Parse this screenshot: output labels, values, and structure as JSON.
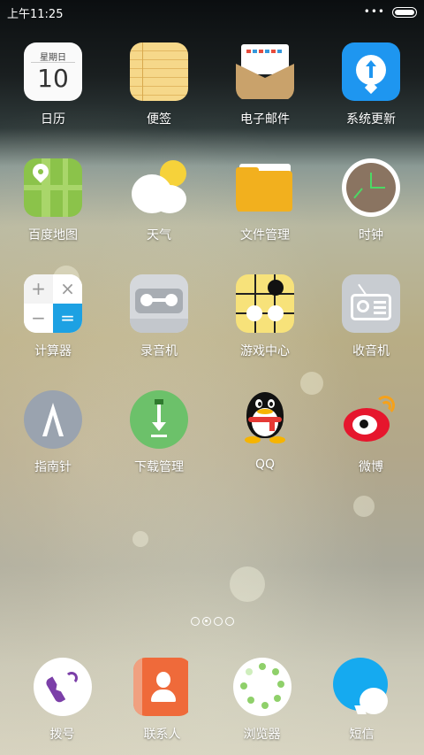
{
  "status_bar": {
    "time": "上午11:25",
    "overflow": "•••"
  },
  "home_grid": [
    [
      {
        "label": "日历",
        "icon": "calendar-icon",
        "sub_text": "星期日",
        "day": "10"
      },
      {
        "label": "便签",
        "icon": "notes-icon"
      },
      {
        "label": "电子邮件",
        "icon": "email-icon"
      },
      {
        "label": "系统更新",
        "icon": "update-icon"
      }
    ],
    [
      {
        "label": "百度地图",
        "icon": "map-icon"
      },
      {
        "label": "天气",
        "icon": "weather-icon"
      },
      {
        "label": "文件管理",
        "icon": "folder-icon"
      },
      {
        "label": "时钟",
        "icon": "clock-icon"
      }
    ],
    [
      {
        "label": "计算器",
        "icon": "calculator-icon"
      },
      {
        "label": "录音机",
        "icon": "recorder-icon"
      },
      {
        "label": "游戏中心",
        "icon": "game-center-icon"
      },
      {
        "label": "收音机",
        "icon": "radio-icon"
      }
    ],
    [
      {
        "label": "指南针",
        "icon": "compass-icon"
      },
      {
        "label": "下载管理",
        "icon": "download-icon"
      },
      {
        "label": "QQ",
        "icon": "qq-icon"
      },
      {
        "label": "微博",
        "icon": "weibo-icon"
      }
    ]
  ],
  "page_indicator": {
    "pages": 4,
    "current": 2
  },
  "dock": [
    {
      "label": "拨号",
      "icon": "phone-icon"
    },
    {
      "label": "联系人",
      "icon": "contacts-icon"
    },
    {
      "label": "浏览器",
      "icon": "browser-icon"
    },
    {
      "label": "短信",
      "icon": "messages-icon"
    }
  ],
  "colors": {
    "calculator_accent": "#1da1e3",
    "update_blue": "#1e96f0",
    "download_green": "#6cc16a",
    "contacts_orange": "#ef6a3a",
    "messages_blue": "#15aaf0"
  }
}
